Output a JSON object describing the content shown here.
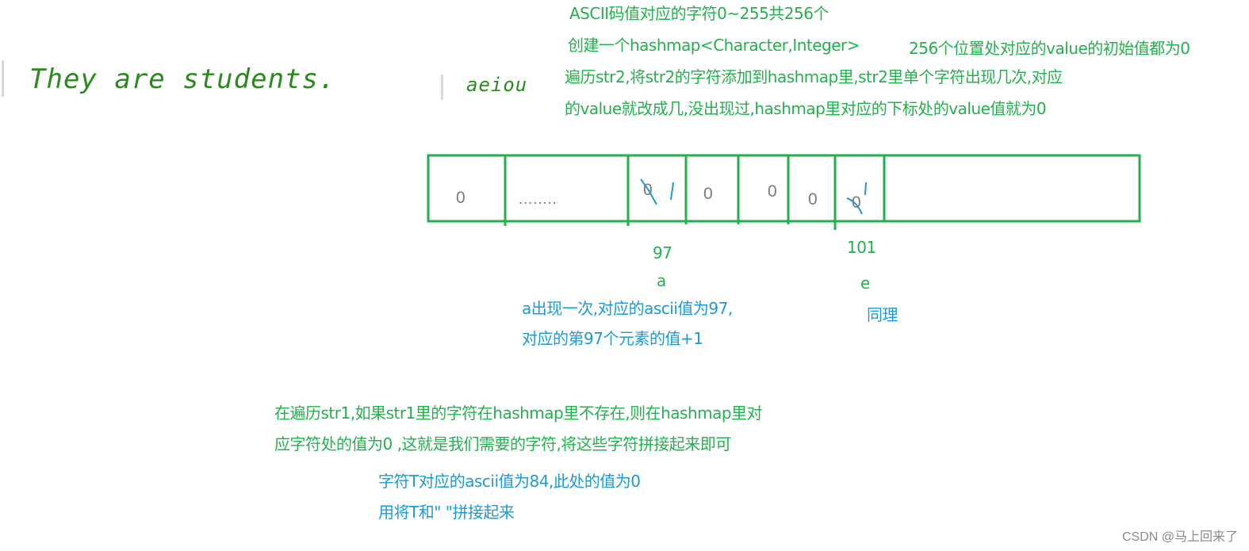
{
  "code_samples": {
    "str1": "They are students.",
    "str2": "aeiou"
  },
  "notes": {
    "line1": "ASCII码值对应的字符0~255共256个",
    "line2": "创建一个hashmap<Character,Integer>",
    "line2b": "256个位置处对应的value的初始值都为0",
    "line3": "遍历str2,将str2的字符添加到hashmap里,str2里单个字符出现几次,对应",
    "line4": "的value就改成几,没出现过,hashmap里对应的下标处的value值就为0"
  },
  "array": {
    "cells": [
      "0",
      "........",
      "0",
      "0",
      "0",
      "0",
      "0",
      ""
    ],
    "marked_cells": [
      2,
      6
    ],
    "index_labels": [
      {
        "index": "97",
        "char": "a"
      },
      {
        "index": "101",
        "char": "e"
      }
    ]
  },
  "annotations": {
    "a_line1": "a出现一次,对应的ascii值为97,",
    "a_line2": "对应的第97个元素的值+1",
    "e_note": "同理",
    "str1_line1": "在遍历str1,如果str1里的字符在hashmap里不存在,则在hashmap里对",
    "str1_line2": "应字符处的值为0 ,这就是我们需要的字符,将这些字符拼接起来即可",
    "t_line1": "字符T对应的ascii值为84,此处的值为0",
    "t_line2": "用将T和\" \"拼接起来"
  },
  "colors": {
    "green": "#22b14c",
    "blue": "#1a9ad9"
  },
  "watermark": "CSDN @马上回来了"
}
